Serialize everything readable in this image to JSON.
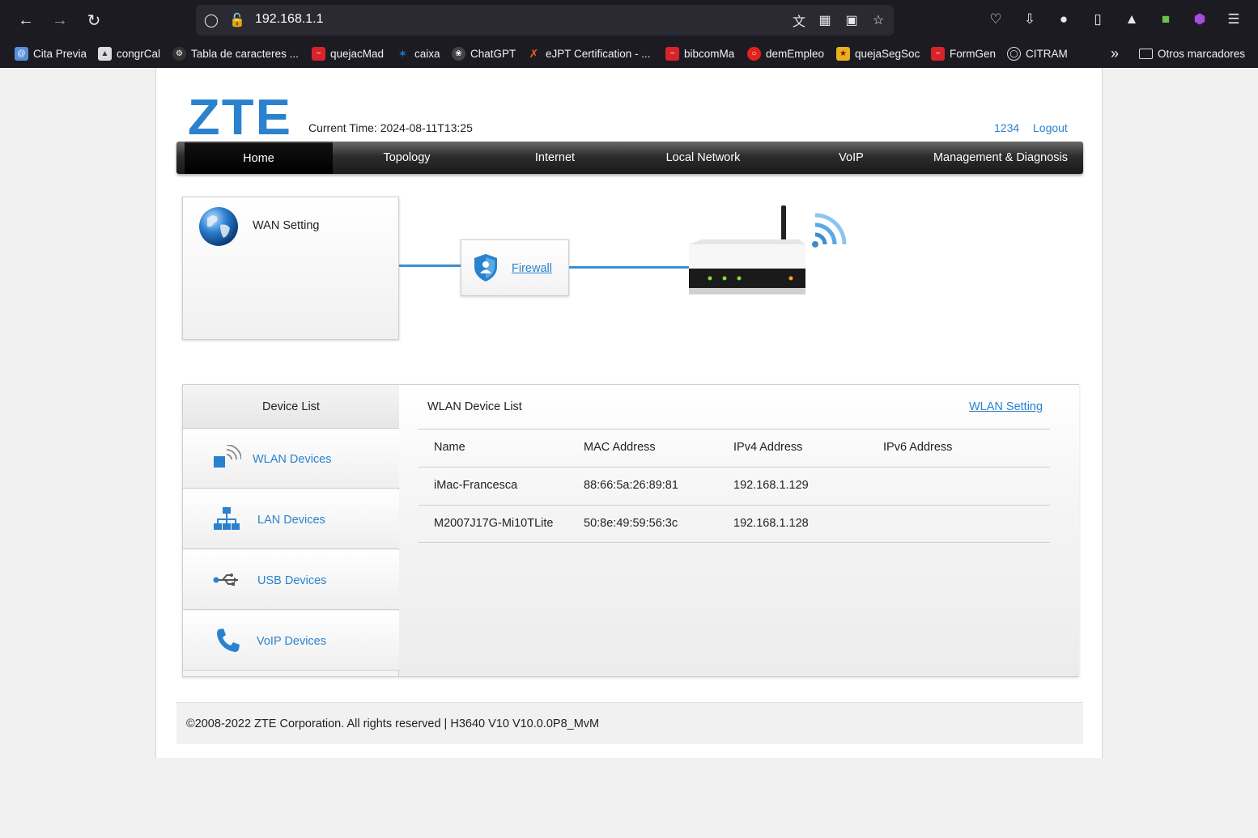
{
  "browser": {
    "url": "192.168.1.1",
    "bookmarks": [
      {
        "label": "Cita Previa",
        "color": "#5a8fd8"
      },
      {
        "label": "congrCal",
        "color": "#dddddd"
      },
      {
        "label": "Tabla de caracteres ...",
        "color": "#333333"
      },
      {
        "label": "quejacMad",
        "color": "#d8232a"
      },
      {
        "label": "caixa",
        "color": "#1a78c2"
      },
      {
        "label": "ChatGPT",
        "color": "#444444"
      },
      {
        "label": "eJPT Certification - ...",
        "color": "#e8611c"
      },
      {
        "label": "bibcomMa",
        "color": "#d8232a"
      },
      {
        "label": "demEmpleo",
        "color": "#e2231a"
      },
      {
        "label": "quejaSegSoc",
        "color": "#e8b020"
      },
      {
        "label": "FormGen",
        "color": "#d8232a"
      },
      {
        "label": "CITRAM",
        "color": "#555555"
      }
    ],
    "other_bookmarks": "Otros marcadores"
  },
  "header": {
    "logo": "ZTE",
    "current_time": "Current Time: 2024-08-11T13:25",
    "user": "1234",
    "logout": "Logout"
  },
  "menu": [
    "Home",
    "Topology",
    "Internet",
    "Local Network",
    "VoIP",
    "Management & Diagnosis"
  ],
  "topology": {
    "wan_setting": "WAN Setting",
    "firewall": "Firewall"
  },
  "device_list": {
    "title": "Device List",
    "items": [
      "WLAN Devices",
      "LAN Devices",
      "USB Devices",
      "VoIP Devices"
    ]
  },
  "wlan_list": {
    "title": "WLAN Device List",
    "setting_link": "WLAN Setting",
    "columns": [
      "Name",
      "MAC Address",
      "IPv4 Address",
      "IPv6 Address"
    ],
    "rows": [
      [
        "iMac-Francesca",
        "88:66:5a:26:89:81",
        "192.168.1.129",
        ""
      ],
      [
        "M2007J17G-Mi10TLite",
        "50:8e:49:59:56:3c",
        "192.168.1.128",
        ""
      ]
    ]
  },
  "footer": "©2008-2022 ZTE Corporation. All rights reserved  |   H3640 V10 V10.0.0P8_MvM",
  "colors": {
    "accent": "#2a82cf",
    "menu_bg": "#1a1a1a"
  }
}
